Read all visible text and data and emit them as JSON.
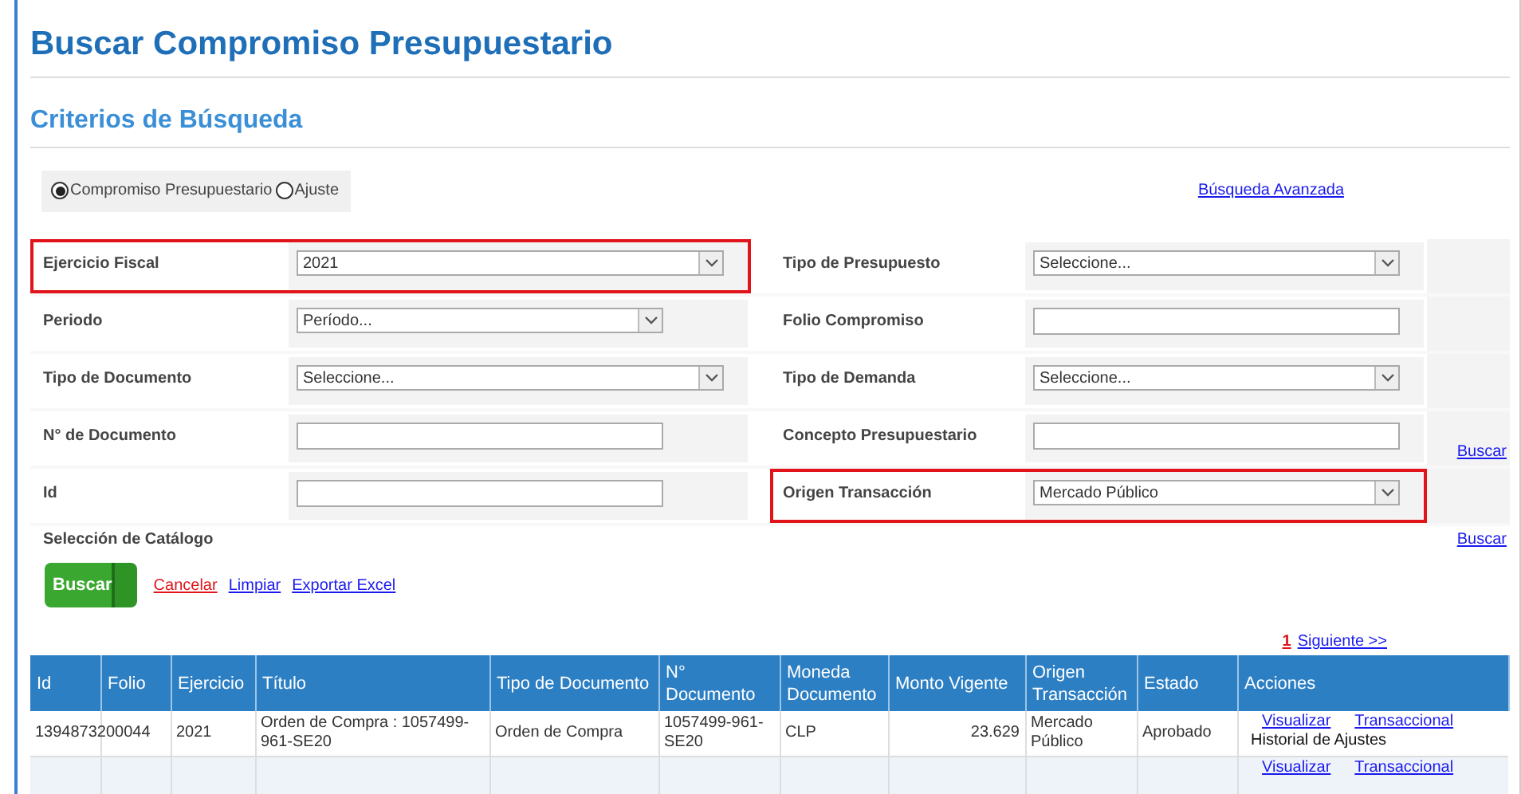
{
  "title": "Buscar Compromiso Presupuestario",
  "subtitle": "Criterios de Búsqueda",
  "radios": [
    {
      "label": "Compromiso Presupuestario",
      "selected": true
    },
    {
      "label": "Ajuste",
      "selected": false
    }
  ],
  "advanced_link": "Búsqueda Avanzada",
  "form_rows": [
    {
      "left": {
        "label": "Ejercicio Fiscal",
        "kind": "select",
        "value": "2021",
        "highlighted": true
      },
      "right": {
        "label": "Tipo de Presupuesto",
        "kind": "select",
        "value": "Seleccione...",
        "highlighted": false
      }
    },
    {
      "left": {
        "label": "Periodo",
        "kind": "select-short",
        "value": "Período...",
        "highlighted": false
      },
      "right": {
        "label": "Folio Compromiso",
        "kind": "text",
        "highlighted": false
      }
    },
    {
      "left": {
        "label": "Tipo de Documento",
        "kind": "select",
        "value": "Seleccione...",
        "highlighted": false
      },
      "right": {
        "label": "Tipo de Demanda",
        "kind": "select",
        "value": "Seleccione...",
        "highlighted": false
      }
    },
    {
      "left": {
        "label": "N° de Documento",
        "kind": "text",
        "highlighted": false
      },
      "right": {
        "label": "Concepto Presupuestario",
        "kind": "text",
        "highlighted": false
      },
      "link": "Buscar"
    },
    {
      "left": {
        "label": "Id",
        "kind": "text",
        "highlighted": false
      },
      "right": {
        "label": "Origen Transacción",
        "kind": "select",
        "value": "Mercado Público",
        "highlighted": true
      }
    }
  ],
  "catalog": {
    "label": "Selección de Catálogo",
    "link": "Buscar"
  },
  "actions": [
    {
      "kind": "button",
      "label": "Buscar"
    },
    {
      "kind": "danger-link",
      "label": "Cancelar"
    },
    {
      "kind": "link",
      "label": "Limpiar"
    },
    {
      "kind": "link",
      "label": "Exportar Excel"
    }
  ],
  "pagination": [
    {
      "label": "1",
      "selected": true
    },
    {
      "label": "Siguiente >>",
      "selected": false
    }
  ],
  "table": {
    "columns": [
      "Id",
      "Folio",
      "Ejercicio",
      "Título",
      "Tipo de Documento",
      "N° Documento",
      "Moneda Documento",
      "Monto Vigente",
      "Origen Transacción",
      "Estado",
      "Acciones"
    ],
    "rows": [
      {
        "cells": [
          "13948732",
          "00044",
          "2021",
          "Orden de Compra : 1057499-961-SE20",
          "Orden de Compra",
          "1057499-961-SE20",
          "CLP",
          "23.629",
          "Mercado Público",
          "Aprobado"
        ],
        "links": [
          "Visualizar",
          "Transaccional"
        ],
        "note": "Historial de Ajustes"
      },
      {
        "cells": [],
        "links": [
          "Visualizar",
          "Transaccional"
        ]
      }
    ]
  }
}
